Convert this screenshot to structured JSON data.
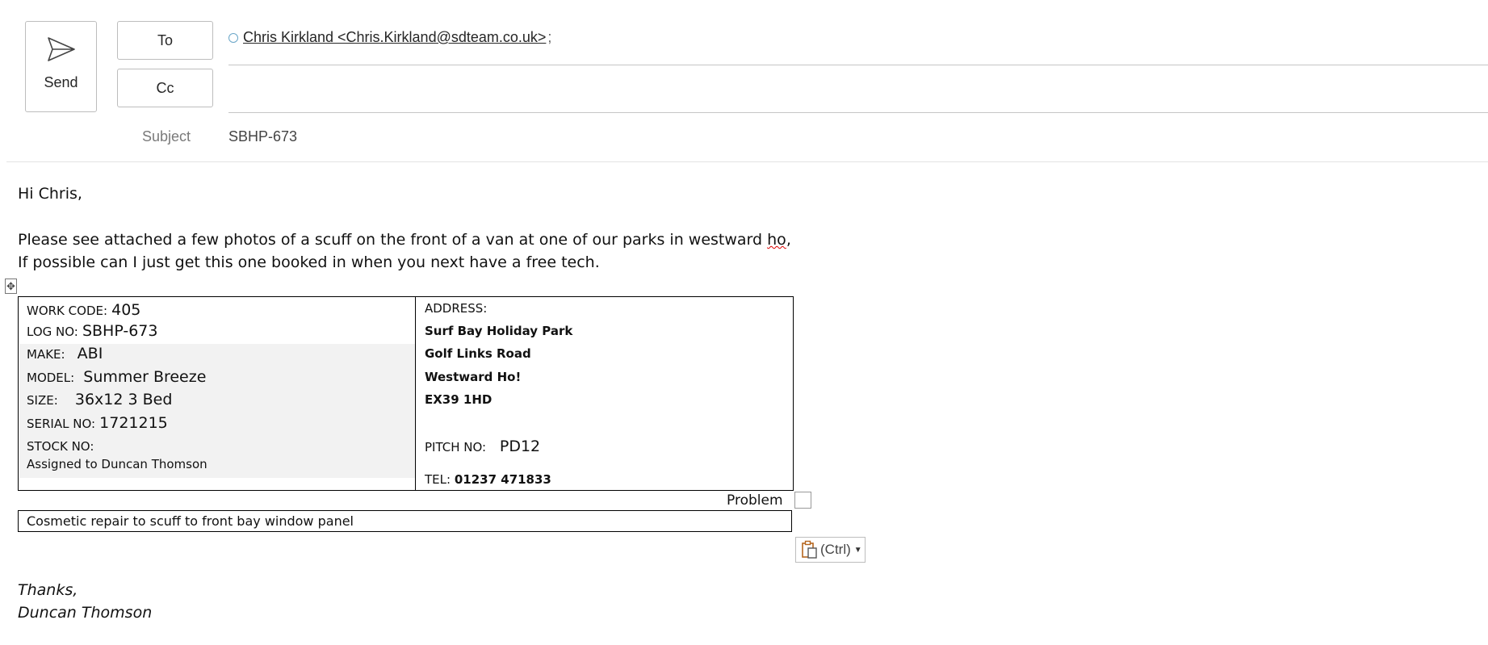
{
  "header": {
    "send_label": "Send",
    "to_label": "To",
    "cc_label": "Cc",
    "to_recipient": "Chris Kirkland <Chris.Kirkland@sdteam.co.uk>",
    "to_separator": ";",
    "cc_value": "",
    "subject_label": "Subject",
    "subject_value": "SBHP-673"
  },
  "body": {
    "greeting": "Hi Chris,",
    "para1_main": "Please see attached a few photos of a scuff on the front of a van at one of our parks in westward ",
    "para1_flagged": "ho",
    "para1_end": ",",
    "para2": "If possible can I just get this one booked in when you next have a free tech."
  },
  "table": {
    "move_handle": "✥",
    "left": {
      "work_code_label": "WORK CODE:",
      "work_code": "405",
      "log_no_label": "LOG NO:",
      "log_no": "SBHP-673",
      "make_label": "MAKE:",
      "make": "ABI",
      "model_label": "MODEL:",
      "model": "Summer Breeze",
      "size_label": "SIZE:",
      "size": "36x12 3 Bed",
      "serial_label": "SERIAL NO:",
      "serial": "1721215",
      "stock_label": "STOCK NO:",
      "stock": "",
      "assigned": "Assigned to Duncan Thomson"
    },
    "right": {
      "address_label": "ADDRESS:",
      "address_lines": [
        "Surf Bay Holiday Park",
        "Golf Links Road",
        "Westward Ho!",
        "EX39 1HD"
      ],
      "pitch_label": "PITCH NO:",
      "pitch": "PD12",
      "tel_label": "TEL:",
      "tel": "01237 471833"
    }
  },
  "problem": {
    "label": "Problem",
    "description": "Cosmetic repair to scuff to front bay window panel"
  },
  "paste_options": {
    "label": "(Ctrl)"
  },
  "signature": {
    "thanks": "Thanks,",
    "name": "Duncan Thomson"
  }
}
